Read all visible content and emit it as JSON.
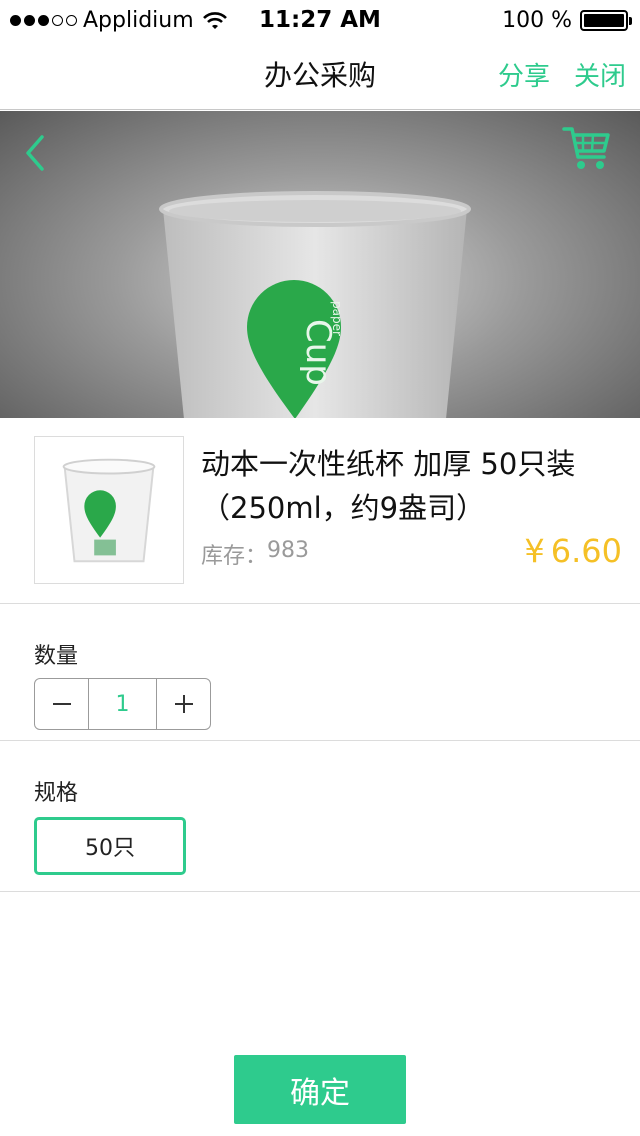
{
  "status_bar": {
    "carrier": "Applidium",
    "time": "11:27 AM",
    "battery": "100 %"
  },
  "navbar": {
    "title": "办公采购",
    "share": "分享",
    "close": "关闭"
  },
  "hero": {
    "cup_text": "Cup",
    "cup_small_text": "paper"
  },
  "product": {
    "name": "动本一次性纸杯 加厚 50只装（250ml，约9盎司）",
    "stock_label": "库存：",
    "stock_value": "983",
    "currency": "¥",
    "price": "6.60"
  },
  "quantity": {
    "label": "数量",
    "value": "1"
  },
  "spec": {
    "label": "规格",
    "option": "50只"
  },
  "confirm_label": "确定",
  "colors": {
    "accent": "#2ecb8d",
    "price": "#f5c026"
  },
  "icons": [
    "wifi-icon",
    "battery-icon",
    "back-icon",
    "cart-icon",
    "minus-icon",
    "plus-icon"
  ]
}
